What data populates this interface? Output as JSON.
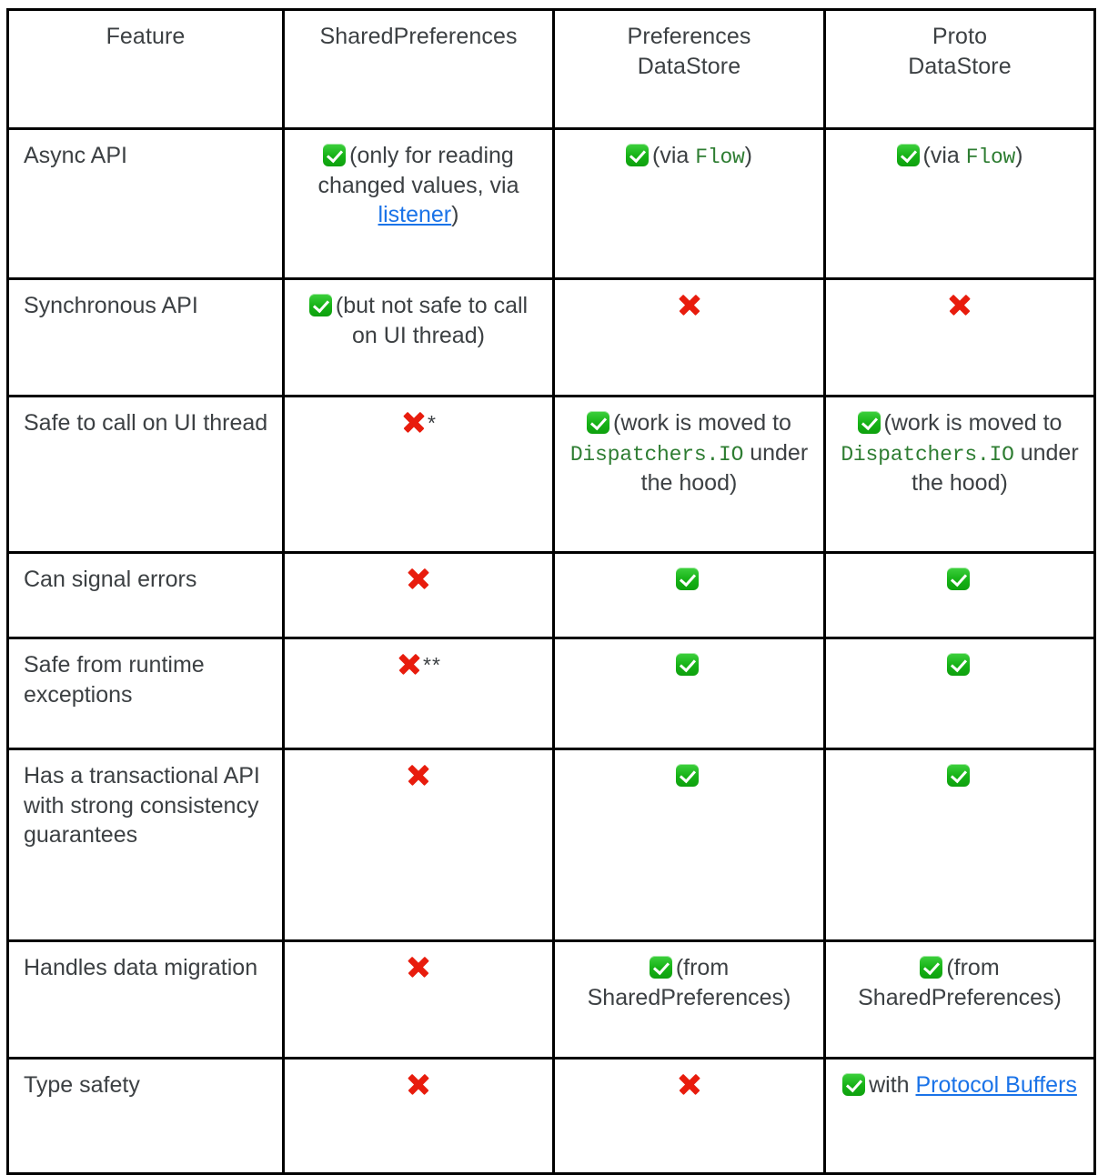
{
  "table": {
    "name": "SharedPreferences vs DataStore comparison",
    "columns": [
      {
        "id": "feature",
        "label": "Feature"
      },
      {
        "id": "sharedpreferences",
        "label": "SharedPreferences"
      },
      {
        "id": "preferences_datastore",
        "label": "Preferences\nDataStore",
        "line1": "Preferences",
        "line2": "DataStore"
      },
      {
        "id": "proto_datastore",
        "label": "Proto\nDataStore",
        "line1": "Proto",
        "line2": "DataStore"
      }
    ],
    "rows": [
      {
        "feature": "Async API",
        "sharedpreferences": {
          "icon": "check-icon",
          "text_before": "(only for reading changed values, via ",
          "link": "listener",
          "text_after": ")"
        },
        "preferences_datastore": {
          "icon": "check-icon",
          "text_before": "(via ",
          "code": "Flow",
          "text_after": ")"
        },
        "proto_datastore": {
          "icon": "check-icon",
          "text_before": "(via ",
          "code": "Flow",
          "text_after": ")"
        }
      },
      {
        "feature": "Synchronous API",
        "sharedpreferences": {
          "icon": "check-icon",
          "text_before": "(but not safe to call on UI thread)"
        },
        "preferences_datastore": {
          "icon": "cross-icon"
        },
        "proto_datastore": {
          "icon": "cross-icon"
        }
      },
      {
        "feature": "Safe to call on UI thread",
        "sharedpreferences": {
          "icon": "cross-icon",
          "note": "*"
        },
        "preferences_datastore": {
          "icon": "check-icon",
          "text_before": "(work is moved to ",
          "code": "Dispatchers.IO",
          "text_after": " under the hood)"
        },
        "proto_datastore": {
          "icon": "check-icon",
          "text_before": "(work is moved to ",
          "code": "Dispatchers.IO",
          "text_after": " under the hood)"
        }
      },
      {
        "feature": "Can signal errors",
        "sharedpreferences": {
          "icon": "cross-icon"
        },
        "preferences_datastore": {
          "icon": "check-icon"
        },
        "proto_datastore": {
          "icon": "check-icon"
        }
      },
      {
        "feature": "Safe from runtime exceptions",
        "sharedpreferences": {
          "icon": "cross-icon",
          "note": "**"
        },
        "preferences_datastore": {
          "icon": "check-icon"
        },
        "proto_datastore": {
          "icon": "check-icon"
        }
      },
      {
        "feature": "Has a transactional API with strong consistency guarantees",
        "sharedpreferences": {
          "icon": "cross-icon"
        },
        "preferences_datastore": {
          "icon": "check-icon"
        },
        "proto_datastore": {
          "icon": "check-icon"
        }
      },
      {
        "feature": "Handles data migration",
        "sharedpreferences": {
          "icon": "cross-icon"
        },
        "preferences_datastore": {
          "icon": "check-icon",
          "text_before": "(from SharedPreferences)"
        },
        "proto_datastore": {
          "icon": "check-icon",
          "text_before": "(from SharedPreferences)"
        }
      },
      {
        "feature": "Type safety",
        "sharedpreferences": {
          "icon": "cross-icon"
        },
        "preferences_datastore": {
          "icon": "cross-icon"
        },
        "proto_datastore": {
          "icon": "check-icon",
          "text_before": "with ",
          "link": "Protocol Buffers"
        }
      }
    ]
  },
  "colors": {
    "text": "#3c4043",
    "border": "#000000",
    "link": "#1a73e8",
    "code_green": "#2e7d32",
    "check_green": "#17b317",
    "cross_red": "#e81c0d",
    "background": "#ffffff"
  }
}
